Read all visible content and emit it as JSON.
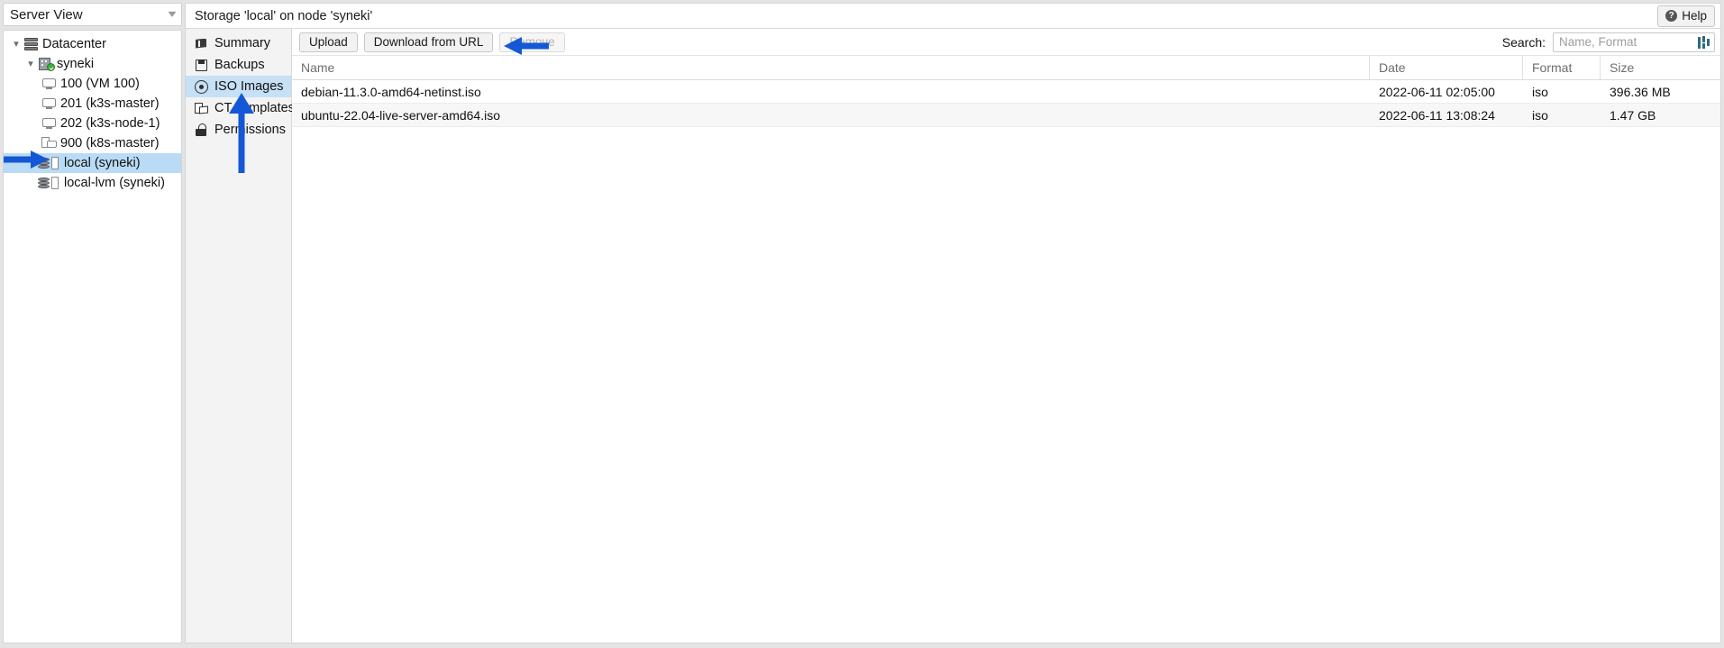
{
  "view_selector": {
    "label": "Server View",
    "chevron_icon": "chevron-down-icon"
  },
  "tree": {
    "items": [
      {
        "label": "Datacenter",
        "icon": "datacenter-icon",
        "indent": 0,
        "twisty": "expanded",
        "selected": false
      },
      {
        "label": "syneki",
        "icon": "node-online-icon",
        "indent": 1,
        "twisty": "expanded",
        "selected": false
      },
      {
        "label": "100 (VM 100)",
        "icon": "vm-icon",
        "indent": 2,
        "twisty": "none",
        "selected": false
      },
      {
        "label": "201 (k3s-master)",
        "icon": "vm-icon",
        "indent": 2,
        "twisty": "none",
        "selected": false
      },
      {
        "label": "202 (k3s-node-1)",
        "icon": "vm-icon",
        "indent": 2,
        "twisty": "none",
        "selected": false
      },
      {
        "label": "900 (k8s-master)",
        "icon": "template-icon",
        "indent": 2,
        "twisty": "none",
        "selected": false
      },
      {
        "label": "local (syneki)",
        "icon": "storage-icon",
        "indent": 2,
        "twisty": "none",
        "selected": true
      },
      {
        "label": "local-lvm (syneki)",
        "icon": "storage-icon",
        "indent": 2,
        "twisty": "none",
        "selected": false
      }
    ]
  },
  "header": {
    "title": "Storage 'local' on node 'syneki'",
    "help_label": "Help",
    "help_icon": "question-mark-icon"
  },
  "menu": {
    "items": [
      {
        "label": "Summary",
        "icon": "book-icon",
        "active": false
      },
      {
        "label": "Backups",
        "icon": "floppy-disk-icon",
        "active": false
      },
      {
        "label": "ISO Images",
        "icon": "disc-icon",
        "active": true
      },
      {
        "label": "CT Templates",
        "icon": "template-box-icon",
        "active": false
      },
      {
        "label": "Permissions",
        "icon": "unlock-icon",
        "active": false
      }
    ]
  },
  "toolbar": {
    "upload_label": "Upload",
    "download_label": "Download from URL",
    "remove_label": "Remove",
    "remove_disabled": true,
    "search_label": "Search:",
    "search_value": "",
    "search_placeholder": "Name, Format",
    "filter_icon": "column-filter-icon"
  },
  "table": {
    "columns": [
      {
        "key": "name",
        "label": "Name"
      },
      {
        "key": "date",
        "label": "Date"
      },
      {
        "key": "format",
        "label": "Format"
      },
      {
        "key": "size",
        "label": "Size"
      }
    ],
    "rows": [
      {
        "name": "debian-11.3.0-amd64-netinst.iso",
        "date": "2022-06-11 02:05:00",
        "format": "iso",
        "size": "396.36 MB"
      },
      {
        "name": "ubuntu-22.04-live-server-amd64.iso",
        "date": "2022-06-11 13:08:24",
        "format": "iso",
        "size": "1.47 GB"
      }
    ]
  },
  "annotations": {
    "color": "#1558d6",
    "arrows": [
      {
        "name": "arrow-pointing-to-local-storage",
        "direction": "right"
      },
      {
        "name": "arrow-pointing-to-iso-images",
        "direction": "up"
      },
      {
        "name": "arrow-pointing-to-download-from-url",
        "direction": "left"
      }
    ]
  },
  "colors": {
    "selection_blue": "#b9dbf5",
    "menu_active_blue": "#c6e0f5",
    "annotation_blue": "#1558d6",
    "page_bg": "#e4e4e4"
  }
}
